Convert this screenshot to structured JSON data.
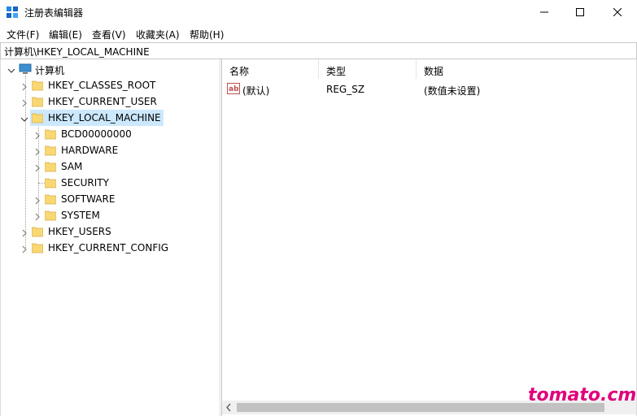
{
  "window": {
    "title": "注册表编辑器",
    "icon": "regedit-icon",
    "controls": [
      "minimize-icon",
      "maximize-icon",
      "close-icon"
    ]
  },
  "menubar": {
    "items": [
      "文件(F)",
      "编辑(E)",
      "查看(V)",
      "收藏夹(A)",
      "帮助(H)"
    ]
  },
  "address": {
    "path": "计算机\\HKEY_LOCAL_MACHINE"
  },
  "tree": {
    "root": "计算机",
    "hives": [
      {
        "label": "HKEY_CLASSES_ROOT"
      },
      {
        "label": "HKEY_CURRENT_USER"
      },
      {
        "label": "HKEY_LOCAL_MACHINE",
        "selected": true,
        "expanded": true
      },
      {
        "label": "HKEY_USERS"
      },
      {
        "label": "HKEY_CURRENT_CONFIG"
      }
    ],
    "hklm_children": [
      {
        "label": "BCD00000000",
        "expandable": true
      },
      {
        "label": "HARDWARE",
        "expandable": true
      },
      {
        "label": "SAM",
        "expandable": true
      },
      {
        "label": "SECURITY",
        "expandable": false
      },
      {
        "label": "SOFTWARE",
        "expandable": true
      },
      {
        "label": "SYSTEM",
        "expandable": true
      }
    ]
  },
  "list": {
    "columns": [
      "名称",
      "类型",
      "数据"
    ],
    "rows": [
      {
        "name": "(默认)",
        "type": "REG_SZ",
        "data": "(数值未设置)",
        "icon": "string-value-icon"
      }
    ]
  },
  "watermark": "tomato.cm",
  "colors": {
    "selection": "#cce8ff",
    "watermark": "#e0007a",
    "folder": "#f8d775"
  }
}
